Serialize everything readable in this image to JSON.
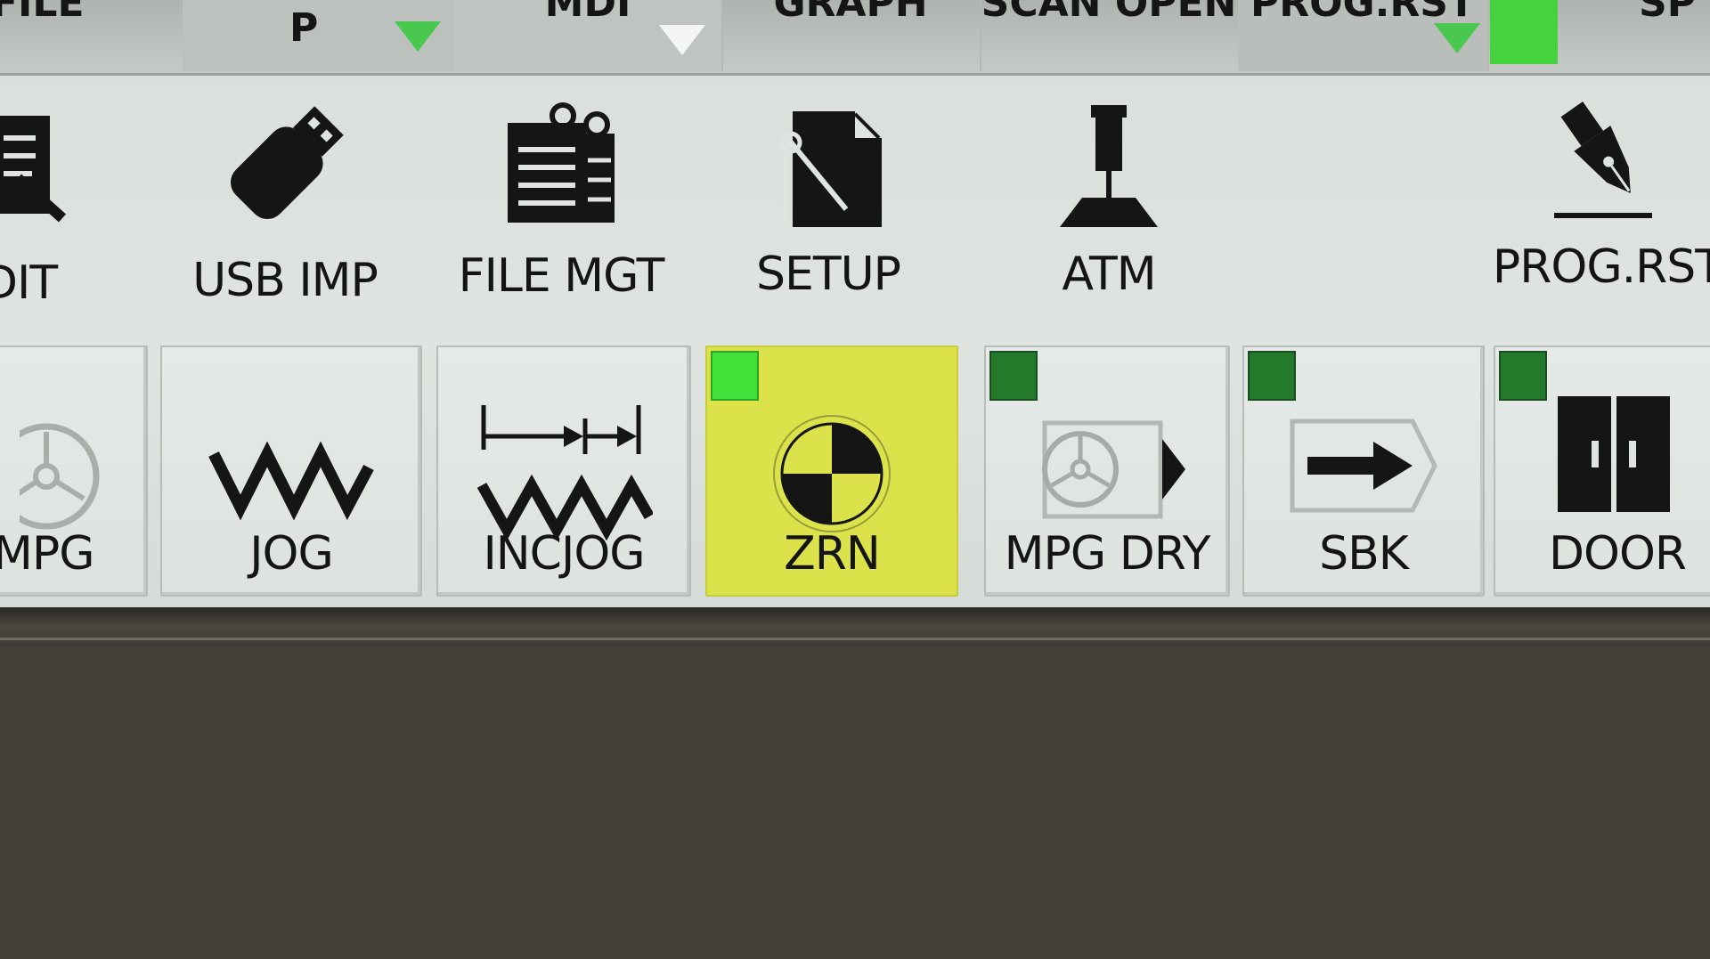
{
  "top_tabs": [
    {
      "id": "file",
      "label": "FILE"
    },
    {
      "id": "p",
      "label": "P"
    },
    {
      "id": "mdi",
      "label": "MDI"
    },
    {
      "id": "graph",
      "label": "GRAPH"
    },
    {
      "id": "scan-open",
      "label": "SCAN OPEN"
    },
    {
      "id": "prog-rst",
      "label": "PROG.RST"
    },
    {
      "id": "sp",
      "label": "SP"
    }
  ],
  "functions": [
    {
      "id": "edit",
      "label": "DIT",
      "icon": "edit-icon"
    },
    {
      "id": "usb-imp",
      "label": "USB IMP",
      "icon": "usb-drive-icon"
    },
    {
      "id": "file-mgt",
      "label": "FILE MGT",
      "icon": "file-manager-icon"
    },
    {
      "id": "setup",
      "label": "SETUP",
      "icon": "setup-document-icon"
    },
    {
      "id": "atm",
      "label": "ATM",
      "icon": "atm-probe-icon"
    },
    {
      "id": "prog-rst",
      "label": "PROG.RST",
      "icon": "fountain-pen-icon"
    }
  ],
  "modes": [
    {
      "id": "mpg",
      "label": "MPG",
      "icon": "handwheel-icon",
      "led": "none"
    },
    {
      "id": "jog",
      "label": "JOG",
      "icon": "zigzag-icon",
      "led": "none"
    },
    {
      "id": "incjog",
      "label": "INCJOG",
      "icon": "incremental-jog-icon",
      "led": "none"
    },
    {
      "id": "zrn",
      "label": "ZRN",
      "icon": "zero-return-icon",
      "led": "on",
      "active": true
    },
    {
      "id": "mpg-dry",
      "label": "MPG DRY",
      "icon": "handwheel-arrow-icon",
      "led": "off"
    },
    {
      "id": "sbk",
      "label": "SBK",
      "icon": "single-block-arrow-icon",
      "led": "off"
    },
    {
      "id": "door",
      "label": "DOOR",
      "icon": "door-icon",
      "led": "off"
    }
  ],
  "colors": {
    "active_mode": "#dbe24a",
    "led_on": "#41e13a",
    "led_off": "#237a2b",
    "tab_indicator": "#49c84f"
  }
}
